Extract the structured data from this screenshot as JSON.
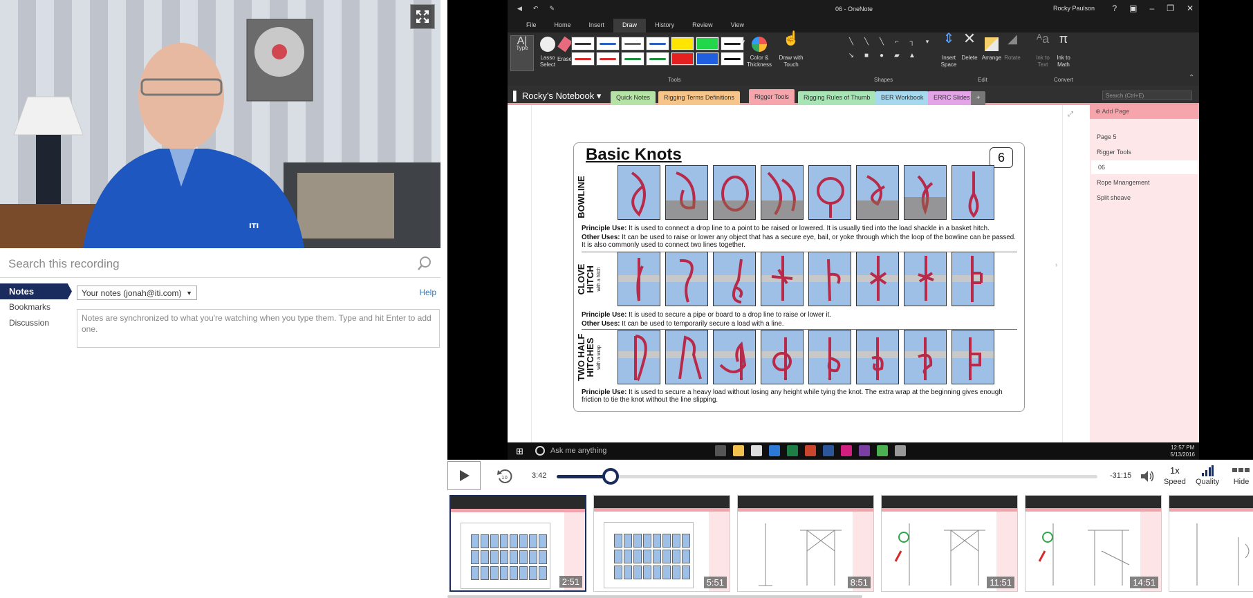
{
  "search": {
    "placeholder": "Search this recording"
  },
  "nav": {
    "items": [
      {
        "label": "Notes",
        "active": true
      },
      {
        "label": "Bookmarks",
        "active": false
      },
      {
        "label": "Discussion",
        "active": false
      }
    ]
  },
  "notes": {
    "select_value": "Your notes (jonah@iti.com)",
    "help_label": "Help",
    "placeholder": "Notes are synchronized to what you're watching when you type them. Type and hit Enter to add one."
  },
  "onenote": {
    "window_title": "06 - OneNote",
    "user": "Rocky Paulson",
    "tabs": [
      "File",
      "Home",
      "Insert",
      "Draw",
      "History",
      "Review",
      "View"
    ],
    "active_tab": "Draw",
    "ribbon": {
      "type_label": "Type",
      "lasso_label": "Lasso Select",
      "eraser_label": "Eraser",
      "color_thickness_label": "Color & Thickness",
      "draw_touch_label": "Draw with Touch",
      "insert_space_label": "Insert Space",
      "delete_label": "Delete",
      "arrange_label": "Arrange",
      "rotate_label": "Rotate",
      "ink_text_label": "Ink to Text",
      "ink_math_label": "Ink to Math",
      "group_tools": "Tools",
      "group_shapes": "Shapes",
      "group_edit": "Edit",
      "group_convert": "Convert"
    },
    "notebook_name": "Rocky's Notebook",
    "sections": [
      {
        "label": "Quick Notes",
        "color": "#b5e3a5"
      },
      {
        "label": "Rigging Terms Definitions",
        "color": "#f5c58a"
      },
      {
        "label": "Rigger Tools",
        "color": "#f6a5ad"
      },
      {
        "label": "Rigging Rules of Thumb",
        "color": "#a9e4b6"
      },
      {
        "label": "BER Workbook",
        "color": "#a6d8ee"
      },
      {
        "label": "ERRC Slides",
        "color": "#e3a4e8"
      }
    ],
    "search_placeholder": "Search (Ctrl+E)",
    "add_page_label": "Add Page",
    "pages": [
      {
        "label": "Page 5",
        "selected": false
      },
      {
        "label": "Rigger Tools",
        "selected": false
      },
      {
        "label": "06",
        "selected": true
      },
      {
        "label": "Rope Mnangement",
        "selected": false
      },
      {
        "label": "Split sheave",
        "selected": false
      }
    ],
    "knots_sheet": {
      "title": "Basic Knots",
      "number": "6",
      "sections": [
        {
          "name": "BOWLINE",
          "sub": "",
          "principle_label": "Principle Use:",
          "principle": "It is used to connect a drop line to a point to be raised or lowered. It is usually tied into the load shackle in a basket hitch.",
          "other_label": "Other Uses:",
          "other": "It can be used to raise or lower any object that has a secure eye, bail, or yoke through which the loop of the bowline can be passed. It is also commonly used to connect two lines together."
        },
        {
          "name": "CLOVE HITCH",
          "sub": "with a hitch",
          "principle_label": "Principle Use:",
          "principle": "It is used to secure a pipe or board to a drop line to raise or lower it.",
          "other_label": "Other Uses:",
          "other": "It can be used to temporarily secure a load with a line."
        },
        {
          "name": "TWO HALF HITCHES",
          "sub": "with a wrap",
          "principle_label": "Principle Use:",
          "principle": "It is used to secure a heavy load without losing any height while tying the knot. The extra wrap at the beginning gives enough friction to tie the knot without the line slipping.",
          "other_label": "",
          "other": ""
        }
      ]
    },
    "taskbar": {
      "ask_placeholder": "Ask me anything",
      "time": "12:57 PM",
      "date": "5/13/2016"
    }
  },
  "player": {
    "current_time": "3:42",
    "remaining_time": "-31:15",
    "progress": 0.1,
    "speed_value": "1x",
    "speed_label": "Speed",
    "quality_label": "Quality",
    "hide_label": "Hide"
  },
  "thumbnails": [
    {
      "time": "2:51",
      "active": true
    },
    {
      "time": "5:51",
      "active": false
    },
    {
      "time": "8:51",
      "active": false
    },
    {
      "time": "11:51",
      "active": false
    },
    {
      "time": "14:51",
      "active": false
    },
    {
      "time": "",
      "active": false
    }
  ],
  "colors": {
    "accent": "#1a2b5e",
    "link": "#2a7ac3",
    "onenote_pink": "#f6a5ad"
  },
  "icons": {
    "expand": "expand-icon",
    "search": "search-icon",
    "play": "play-icon",
    "rewind": "rewind-10-icon",
    "volume": "volume-icon",
    "quality": "signal-bars-icon",
    "hide": "hide-icon"
  }
}
